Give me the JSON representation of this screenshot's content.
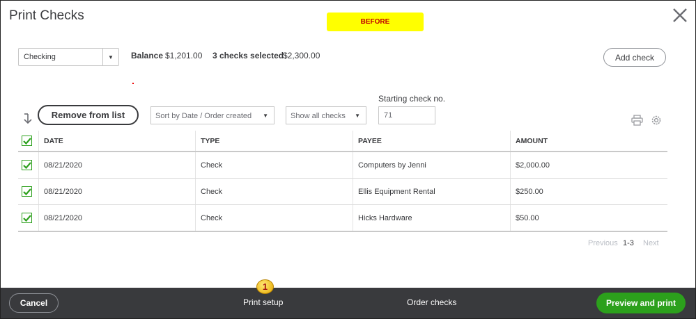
{
  "header": {
    "title": "Print Checks",
    "before_label": "BEFORE"
  },
  "account": {
    "selected": "Checking"
  },
  "summary": {
    "balance_label": "Balance",
    "balance_value": "$1,201.00",
    "selected_label": "3 checks selected",
    "selected_value": "$2,300.00"
  },
  "add_check_label": "Add check",
  "starting_check": {
    "label": "Starting check no.",
    "value": "71"
  },
  "toolbar": {
    "remove_label": "Remove from list",
    "sort_value": "Sort by Date / Order created",
    "filter_value": "Show all checks"
  },
  "table": {
    "headers": [
      "DATE",
      "TYPE",
      "PAYEE",
      "AMOUNT"
    ],
    "rows": [
      {
        "date": "08/21/2020",
        "type": "Check",
        "payee": "Computers by Jenni",
        "amount": "$2,000.00"
      },
      {
        "date": "08/21/2020",
        "type": "Check",
        "payee": "Ellis Equipment Rental",
        "amount": "$250.00"
      },
      {
        "date": "08/21/2020",
        "type": "Check",
        "payee": "Hicks Hardware",
        "amount": "$50.00"
      }
    ]
  },
  "pagination": {
    "previous": "Previous",
    "range": "1-3",
    "next": "Next"
  },
  "footer": {
    "cancel": "Cancel",
    "print_setup": "Print setup",
    "order_checks": "Order checks",
    "preview_print": "Preview and print"
  },
  "annotation": {
    "badge": "1"
  },
  "colors": {
    "accent_green": "#2ca01c",
    "footer_bg": "#393a3d",
    "highlight": "#ffff00",
    "badge_text": "#a31010"
  }
}
